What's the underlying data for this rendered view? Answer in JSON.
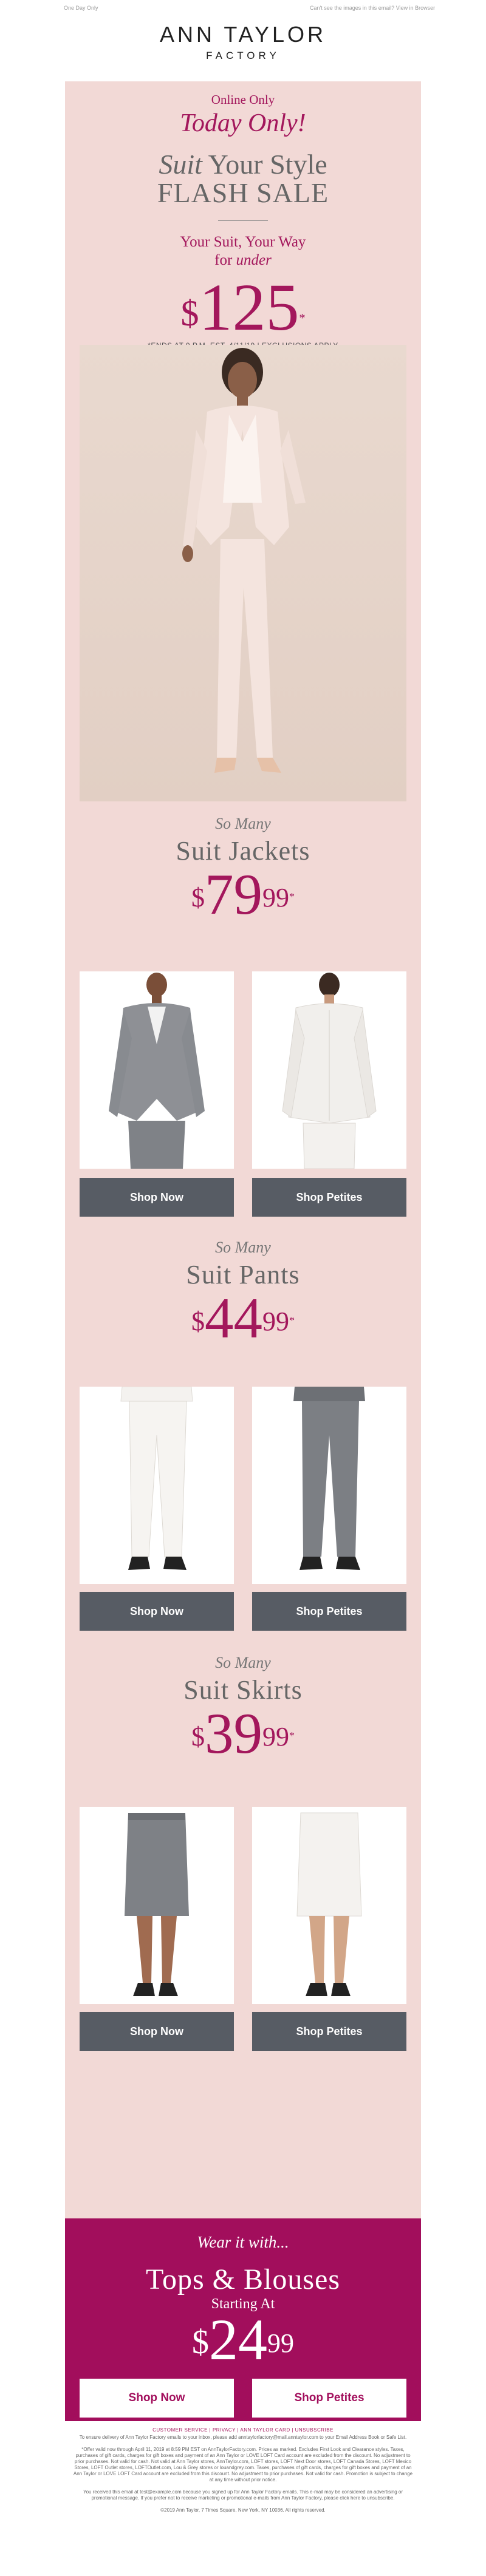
{
  "preheader": {
    "left": "One Day Only",
    "right": "Can't see the images in this email? View in Browser"
  },
  "logo": {
    "brand": "ANN TAYLOR",
    "sub": "FACTORY"
  },
  "hero": {
    "online": "Online Only",
    "today": "Today Only!",
    "suit_word": "Suit",
    "your_style": " Your Style",
    "flash": "FLASH SALE",
    "your_suit": "Your Suit, Your Way",
    "for": "for ",
    "under": "under",
    "dollar": "$",
    "price": "125",
    "asterisk": "*",
    "ends": "*ENDS AT 9 P.M. EST, 4/11/19 | EXCLUSIONS APPLY"
  },
  "sections": [
    {
      "so_many": "So Many",
      "category": "Suit Jackets",
      "dollar": "$",
      "price": "79",
      "cents": "99",
      "asterisk": "*",
      "shop_now": "Shop Now",
      "shop_petites": "Shop Petites"
    },
    {
      "so_many": "So Many",
      "category": "Suit Pants",
      "dollar": "$",
      "price": "44",
      "cents": "99",
      "asterisk": "*",
      "shop_now": "Shop Now",
      "shop_petites": "Shop Petites"
    },
    {
      "so_many": "So Many",
      "category": "Suit Skirts",
      "dollar": "$",
      "price": "39",
      "cents": "99",
      "asterisk": "*",
      "shop_now": "Shop Now",
      "shop_petites": "Shop Petites"
    }
  ],
  "tops": {
    "wear": "Wear it with...",
    "title": "Tops & Blouses",
    "starting": "Starting At",
    "dollar": "$",
    "price": "24",
    "cents": "99",
    "shop_now": "Shop Now",
    "shop_petites": "Shop Petites"
  },
  "footer": {
    "links": "CUSTOMER SERVICE | PRIVACY | ANN TAYLOR CARD | UNSUBSCRIBE",
    "p1": "To ensure delivery of Ann Taylor Factory emails to your inbox, please add anntaylorfactory@mail.anntaylor.com to your Email Address Book or Safe List.",
    "p2": "*Offer valid now through April 11, 2019 at 8:59 PM EST on AnnTaylorFactory.com. Prices as marked. Excludes First Look and Clearance styles. Taxes, purchases of gift cards, charges for gift boxes and payment of an Ann Taylor or LOVE LOFT Card account are excluded from the discount. No adjustment to prior purchases. Not valid for cash. Not valid at Ann Taylor stores, AnnTaylor.com, LOFT stores, LOFT Next Door stores, LOFT Canada Stores, LOFT Mexico Stores, LOFT Outlet stores, LOFTOutlet.com, Lou & Grey stores or louandgrey.com. Taxes, purchases of gift cards, charges for gift boxes and payment of an Ann Taylor or LOVE LOFT Card account are excluded from this discount. No adjustment to prior purchases. Not valid for cash. Promotion is subject to change at any time without prior notice.",
    "p3": "You received this email at test@example.com because you signed up for Ann Taylor Factory emails. This e-mail may be considered an advertising or promotional message. If you prefer not to receive marketing or promotional e-mails from Ann Taylor Factory, please click here to unsubscribe.",
    "p4": "©2019 Ann Taylor, 7 Times Square, New York, NY 10036. All rights reserved."
  },
  "colors": {
    "accent": "#a3175c",
    "panel": "#f2d9d6",
    "button": "#575c64",
    "tops_bg": "#a20e5c"
  }
}
